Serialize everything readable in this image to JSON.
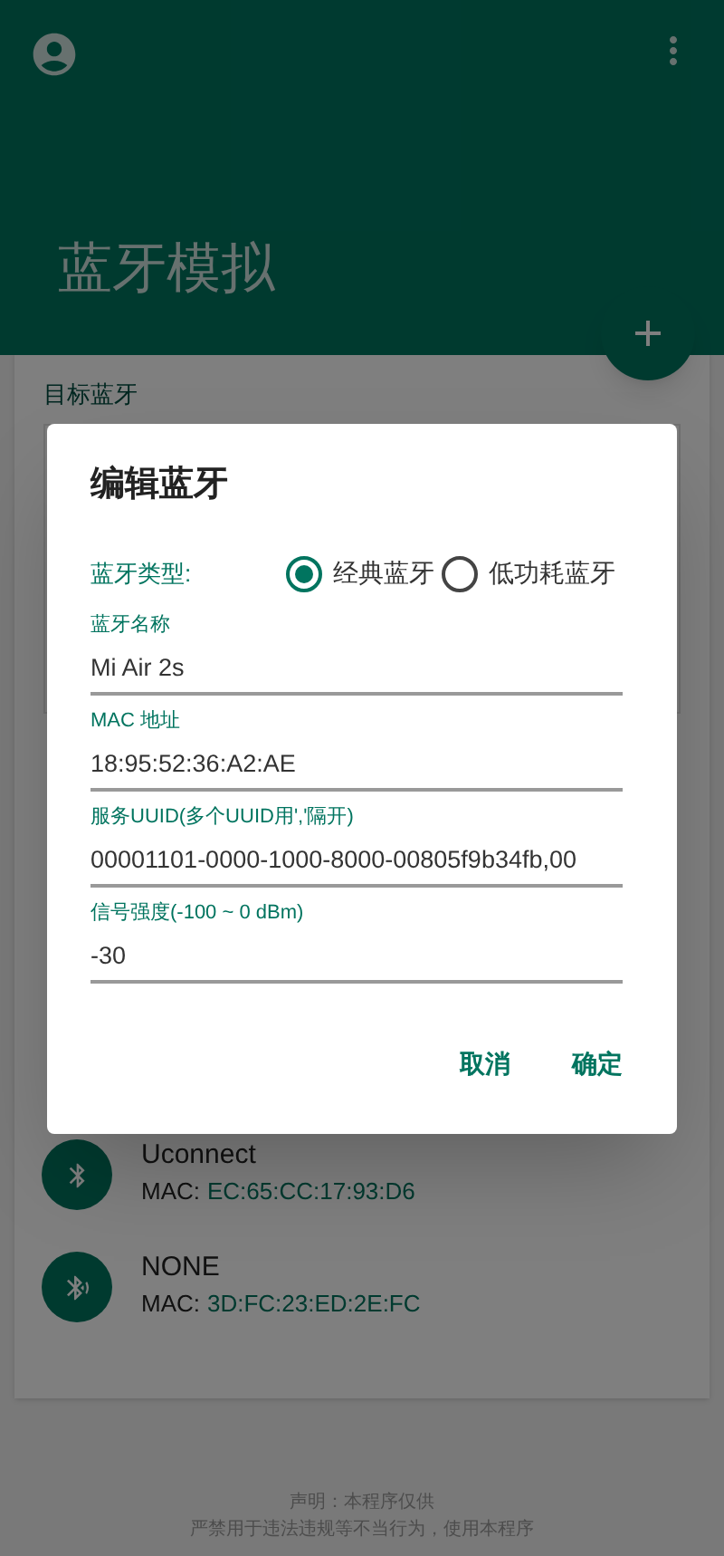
{
  "app_bar": {
    "title": "蓝牙模拟"
  },
  "target_section": {
    "label": "目标蓝牙"
  },
  "devices": [
    {
      "name": "Uconnect",
      "mac_label": "MAC:",
      "mac": "EC:65:CC:17:93:D6",
      "kind": "classic"
    },
    {
      "name": "NONE",
      "mac_label": "MAC:",
      "mac": "3D:FC:23:ED:2E:FC",
      "kind": "le"
    }
  ],
  "footer": [
    "声明：本程序仅供",
    "严禁用于违法违规等不当行为，使用本程序"
  ],
  "dialog": {
    "title": "编辑蓝牙",
    "type_label": "蓝牙类型:",
    "types": [
      {
        "label": "经典蓝牙",
        "selected": true
      },
      {
        "label": "低功耗蓝牙",
        "selected": false
      }
    ],
    "fields": [
      {
        "label": "蓝牙名称",
        "value": "Mi Air 2s"
      },
      {
        "label": "MAC 地址",
        "value": "18:95:52:36:A2:AE"
      },
      {
        "label": "服务UUID(多个UUID用','隔开)",
        "value": "00001101-0000-1000-8000-00805f9b34fb,00"
      },
      {
        "label": "信号强度(-100 ~ 0 dBm)",
        "value": "-30"
      }
    ],
    "buttons": [
      "取消",
      "确定"
    ]
  }
}
